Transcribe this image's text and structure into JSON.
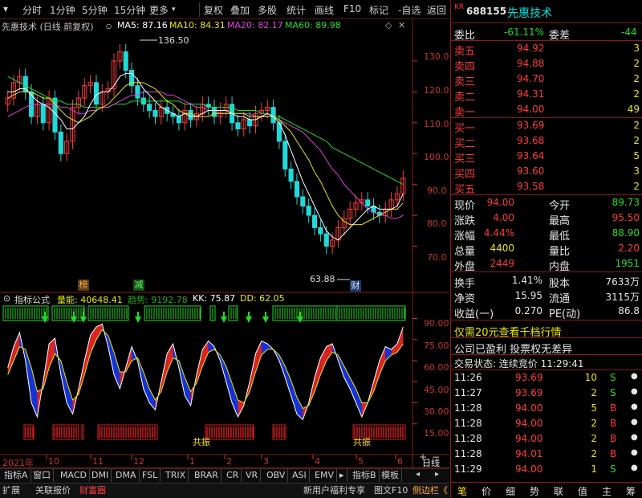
{
  "toolbar": {
    "items": [
      "分时",
      "1分钟",
      "5分钟",
      "15分钟",
      "更多",
      "复权",
      "叠加",
      "多股",
      "统计",
      "画线",
      "F10",
      "标记",
      "-自选",
      "返回"
    ]
  },
  "chart": {
    "title": "先惠技术 (日线 前复权)",
    "ma": [
      {
        "label": "MA5: 87.16",
        "color": "#ffffff"
      },
      {
        "label": "MA10: 84.31",
        "color": "#e8e800"
      },
      {
        "label": "MA20: 82.17",
        "color": "#e040e0"
      },
      {
        "label": "MA60: 89.98",
        "color": "#22dd22"
      }
    ],
    "price_axis": [
      "130.0",
      "120.0",
      "110.0",
      "100.0",
      "90.0",
      "80.0",
      "70.0"
    ],
    "high_marker": "136.50",
    "low_marker": "63.88",
    "tags": {
      "bang": "榜",
      "jian": "减",
      "cai": "财"
    },
    "price_series": [
      118,
      123,
      125,
      120,
      112,
      116,
      110,
      118,
      107,
      100,
      104,
      115,
      118,
      122,
      123,
      116,
      120,
      121,
      130,
      133,
      127,
      122,
      118,
      116,
      114,
      112,
      115,
      113,
      112,
      110,
      114,
      111,
      113,
      116,
      115,
      112,
      114,
      116,
      110,
      108,
      111,
      109,
      113,
      114,
      115,
      110,
      104,
      95,
      91,
      86,
      83,
      80,
      76,
      74,
      70,
      72,
      76,
      79,
      82,
      84,
      85,
      83,
      81,
      80,
      82,
      85,
      87,
      92
    ],
    "ma5": [
      120,
      120,
      121,
      121,
      119,
      117,
      116,
      115,
      113,
      111,
      108,
      108,
      110,
      112,
      116,
      119,
      120,
      120,
      122,
      125,
      126,
      126,
      124,
      121,
      119,
      117,
      115,
      114,
      113,
      112,
      113,
      112,
      112,
      113,
      114,
      114,
      114,
      114,
      113,
      112,
      112,
      111,
      111,
      112,
      113,
      112,
      110,
      106,
      101,
      96,
      91,
      87,
      83,
      79,
      75,
      73,
      72,
      74,
      76,
      78,
      80,
      82,
      83,
      82,
      82,
      82,
      83,
      87
    ],
    "ma10": [
      118,
      119,
      120,
      120,
      120,
      119,
      118,
      118,
      116,
      114,
      112,
      111,
      110,
      111,
      112,
      114,
      115,
      116,
      118,
      120,
      122,
      123,
      123,
      123,
      122,
      121,
      119,
      117,
      116,
      114,
      113,
      113,
      112,
      112,
      112,
      113,
      113,
      113,
      113,
      113,
      113,
      112,
      112,
      112,
      112,
      112,
      111,
      109,
      107,
      104,
      101,
      98,
      94,
      91,
      87,
      83,
      80,
      78,
      77,
      77,
      77,
      78,
      79,
      80,
      81,
      82,
      82,
      84
    ],
    "ma20": [
      112,
      113,
      114,
      115,
      116,
      116,
      116,
      116,
      116,
      115,
      115,
      114,
      113,
      113,
      114,
      114,
      115,
      115,
      116,
      117,
      118,
      119,
      119,
      120,
      120,
      120,
      120,
      119,
      119,
      118,
      117,
      116,
      115,
      115,
      114,
      114,
      113,
      113,
      113,
      113,
      113,
      113,
      112,
      112,
      112,
      112,
      111,
      110,
      109,
      108,
      107,
      105,
      103,
      101,
      98,
      95,
      93,
      90,
      88,
      86,
      84,
      82,
      81,
      80,
      80,
      79,
      79,
      80
    ],
    "ma60": [
      125,
      124,
      123,
      122,
      121,
      120,
      119,
      118,
      117,
      117,
      116,
      116,
      116,
      115,
      115,
      115,
      115,
      115,
      116,
      116,
      116,
      117,
      117,
      117,
      117,
      117,
      117,
      117,
      117,
      117,
      116,
      116,
      116,
      116,
      115,
      115,
      115,
      115,
      115,
      114,
      114,
      114,
      114,
      113,
      113,
      112,
      112,
      111,
      110,
      109,
      108,
      107,
      106,
      105,
      104,
      102,
      101,
      100,
      99,
      98,
      97,
      96,
      95,
      94,
      93,
      92,
      91,
      90
    ]
  },
  "indicator": {
    "name": "指标公式",
    "volume_label": "量能: 40648.41",
    "trend_label": "趋势: 9192.78",
    "kk_label": "KK: 75.87",
    "dd_label": "DD: 62.05",
    "axis": [
      "90.00",
      "75.00",
      "60.00",
      "45.00",
      "30.00",
      "15.00"
    ],
    "resonance": "共振",
    "kk": [
      55,
      70,
      80,
      60,
      30,
      20,
      45,
      72,
      76,
      50,
      30,
      22,
      40,
      60,
      78,
      84,
      86,
      70,
      50,
      40,
      55,
      70,
      60,
      40,
      30,
      25,
      45,
      65,
      72,
      55,
      35,
      28,
      50,
      68,
      74,
      70,
      60,
      45,
      30,
      20,
      28,
      45,
      65,
      74,
      72,
      68,
      60,
      48,
      35,
      22,
      18,
      30,
      48,
      62,
      70,
      72,
      60,
      48,
      40,
      30,
      20,
      30,
      45,
      60,
      70,
      68,
      72,
      84
    ],
    "dd": [
      50,
      60,
      70,
      68,
      55,
      38,
      40,
      55,
      65,
      60,
      45,
      32,
      36,
      50,
      65,
      75,
      82,
      78,
      66,
      52,
      52,
      60,
      62,
      52,
      40,
      32,
      38,
      52,
      62,
      60,
      48,
      38,
      44,
      56,
      66,
      68,
      64,
      56,
      44,
      32,
      30,
      38,
      52,
      64,
      68,
      68,
      64,
      56,
      46,
      34,
      26,
      28,
      38,
      50,
      60,
      66,
      64,
      56,
      48,
      40,
      30,
      30,
      38,
      50,
      60,
      64,
      66,
      72
    ]
  },
  "dates": [
    "2021年",
    "10",
    "11",
    "12",
    "1",
    "2",
    "3",
    "4",
    "5",
    "6",
    "日线"
  ],
  "bottom_tabs": [
    "指标A",
    "窗口",
    "MACD",
    "DMI",
    "DMA",
    "FSL",
    "TRIX",
    "BRAR",
    "CR",
    "VR",
    "OBV",
    "ASI",
    "EMV",
    "指标B",
    "模板"
  ],
  "bottom_bar": {
    "left": [
      "扩展",
      "关联报价",
      "财富圈"
    ],
    "news": "新用户福利专享",
    "f10": "图文F10",
    "sidebar": "侧边栏《"
  },
  "quote": {
    "market_tag": "KR",
    "code": "688155",
    "name": "先惠技术",
    "weibi_label": "委比",
    "weibi": "-61.11%",
    "weicha_label": "委差",
    "weicha": "-44",
    "asks": [
      {
        "label": "卖五",
        "price": "94.92",
        "vol": "3"
      },
      {
        "label": "卖四",
        "price": "94.88",
        "vol": "2"
      },
      {
        "label": "卖三",
        "price": "94.70",
        "vol": "2"
      },
      {
        "label": "卖二",
        "price": "94.31",
        "vol": "2"
      },
      {
        "label": "卖一",
        "price": "94.00",
        "vol": "49"
      }
    ],
    "bids": [
      {
        "label": "买一",
        "price": "93.69",
        "vol": "2"
      },
      {
        "label": "买二",
        "price": "93.68",
        "vol": "2"
      },
      {
        "label": "买三",
        "price": "93.64",
        "vol": "5"
      },
      {
        "label": "买四",
        "price": "93.60",
        "vol": "3"
      },
      {
        "label": "买五",
        "price": "93.58",
        "vol": "2"
      }
    ],
    "stats": [
      {
        "l1": "现价",
        "v1": "94.00",
        "l2": "今开",
        "v2": "89.73"
      },
      {
        "l1": "涨跌",
        "v1": "4.00",
        "l2": "最高",
        "v2": "95.50"
      },
      {
        "l1": "涨幅",
        "v1": "4.44%",
        "l2": "最低",
        "v2": "88.90"
      },
      {
        "l1": "总量",
        "v1": "4400",
        "l2": "量比",
        "v2": "2.20"
      },
      {
        "l1": "外盘",
        "v1": "2449",
        "l2": "内盘",
        "v2": "1951"
      }
    ],
    "fin": [
      {
        "l1": "换手",
        "v1": "1.41%",
        "l2": "股本",
        "v2": "7633万"
      },
      {
        "l1": "净资",
        "v1": "15.95",
        "l2": "流通",
        "v2": "3115万"
      },
      {
        "l1": "收益(一)",
        "v1": "0.270",
        "l2": "PE(动)",
        "v2": "86.8"
      }
    ],
    "promo": "仅需20元查看千档行情",
    "notice": "公司已盈利 投票权无差异",
    "trade_status": "交易状态: 连续竞价 11:29:41",
    "ticks": [
      {
        "time": "11:26",
        "price": "93.69",
        "vol": "10",
        "side": "S"
      },
      {
        "time": "11:27",
        "price": "93.69",
        "vol": "2",
        "side": "S"
      },
      {
        "time": "11:28",
        "price": "94.00",
        "vol": "5",
        "side": "B"
      },
      {
        "time": "11:28",
        "price": "94.00",
        "vol": "2",
        "side": "B"
      },
      {
        "time": "11:28",
        "price": "94.00",
        "vol": "2",
        "side": "B"
      },
      {
        "time": "11:28",
        "price": "94.01",
        "vol": "2",
        "side": "B"
      },
      {
        "time": "11:29",
        "price": "94.00",
        "vol": "1",
        "side": "S"
      }
    ],
    "bottom_tabs": [
      "笔",
      "价",
      "细",
      "势",
      "联",
      "值",
      "主",
      "筹"
    ]
  }
}
